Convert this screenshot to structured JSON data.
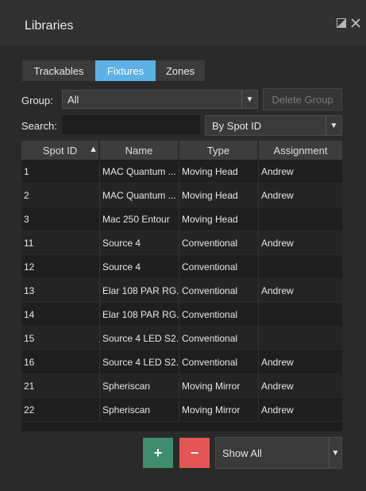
{
  "window": {
    "title": "Libraries",
    "icons": [
      "popout-icon",
      "close-icon"
    ]
  },
  "tabs": [
    {
      "label": "Trackables",
      "active": false
    },
    {
      "label": "Fixtures",
      "active": true
    },
    {
      "label": "Zones",
      "active": false
    }
  ],
  "group": {
    "label": "Group:",
    "value": "All",
    "delete_label": "Delete Group"
  },
  "search": {
    "label": "Search:",
    "value": "",
    "mode": "By Spot ID"
  },
  "table": {
    "columns": [
      "Spot ID",
      "Name",
      "Type",
      "Assignment"
    ],
    "sort_column": "Spot ID",
    "sort_direction": "ascending",
    "rows": [
      [
        "1",
        "MAC Quantum ...",
        "Moving Head",
        "Andrew"
      ],
      [
        "2",
        "MAC Quantum ...",
        "Moving Head",
        "Andrew"
      ],
      [
        "3",
        "Mac 250 Entour",
        "Moving Head",
        ""
      ],
      [
        "11",
        "Source 4",
        "Conventional",
        "Andrew"
      ],
      [
        "12",
        "Source 4",
        "Conventional",
        ""
      ],
      [
        "13",
        "Elar 108 PAR RG...",
        "Conventional",
        "Andrew"
      ],
      [
        "14",
        "Elar 108 PAR RG...",
        "Conventional",
        ""
      ],
      [
        "15",
        "Source 4 LED S2...",
        "Conventional",
        ""
      ],
      [
        "16",
        "Source 4 LED S2...",
        "Conventional",
        "Andrew"
      ],
      [
        "21",
        "Spheriscan",
        "Moving Mirror",
        "Andrew"
      ],
      [
        "22",
        "Spheriscan",
        "Moving Mirror",
        "Andrew"
      ]
    ]
  },
  "footer": {
    "add_label": "+",
    "remove_label": "−",
    "filter_value": "Show All"
  },
  "colors": {
    "accent": "#5cb2e6",
    "add": "#3e8e6e",
    "remove": "#e65555"
  }
}
